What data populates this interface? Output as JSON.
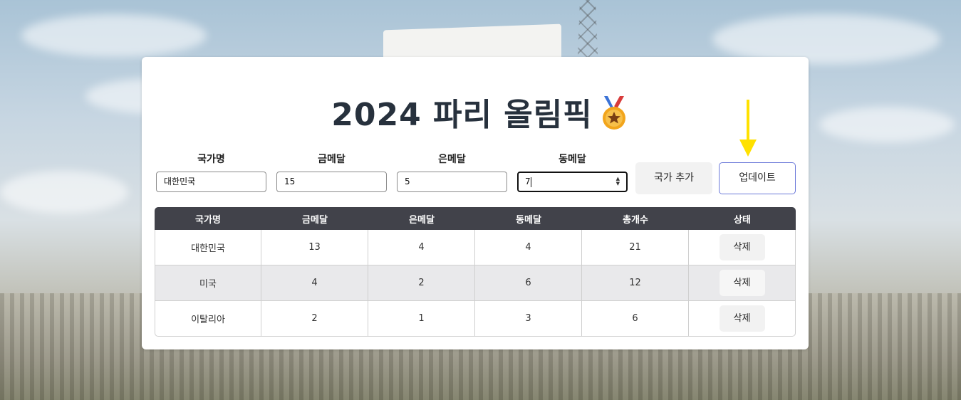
{
  "header": {
    "title": "2024 파리 올림픽"
  },
  "icons": {
    "title_icon": "medal-icon",
    "arrow": "arrow-down-icon"
  },
  "colors": {
    "table_header": "#41424a",
    "update_border": "#6b79d9",
    "arrow": "#ffe100"
  },
  "form": {
    "fields": [
      {
        "label": "국가명",
        "value": "대한민국"
      },
      {
        "label": "금메달",
        "value": "15"
      },
      {
        "label": "은메달",
        "value": "5"
      },
      {
        "label": "동메달",
        "value": "7"
      }
    ],
    "add_button": "국가 추가",
    "update_button": "업데이트"
  },
  "table": {
    "columns": [
      "국가명",
      "금메달",
      "은메달",
      "동메달",
      "총개수",
      "상태"
    ],
    "rows": [
      {
        "country": "대한민국",
        "gold": "13",
        "silver": "4",
        "bronze": "4",
        "total": "21",
        "action": "삭제"
      },
      {
        "country": "미국",
        "gold": "4",
        "silver": "2",
        "bronze": "6",
        "total": "12",
        "action": "삭제"
      },
      {
        "country": "이탈리아",
        "gold": "2",
        "silver": "1",
        "bronze": "3",
        "total": "6",
        "action": "삭제"
      }
    ]
  }
}
